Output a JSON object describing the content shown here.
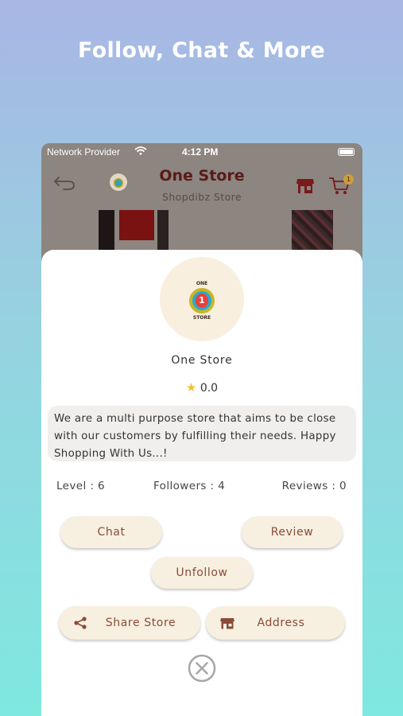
{
  "headline": "Follow, Chat & More",
  "status_bar": {
    "carrier": "Network Provider",
    "time": "4:12 PM"
  },
  "app_bar": {
    "title": "One Store",
    "subtitle": "Shopdibz Store",
    "cart_count": "1",
    "icons": [
      "back-arrow-icon",
      "store-logo-icon",
      "shop-icon",
      "cart-icon"
    ]
  },
  "store_card": {
    "name": "One Store",
    "rating": "0.0",
    "description": "We are a multi purpose store that aims to be close with our customers by fulfilling their needs. Happy Shopping With Us...!",
    "stats": {
      "level": "Level : 6",
      "followers": "Followers : 4",
      "reviews": "Reviews : 0"
    },
    "logo": {
      "top_text": "ONE",
      "number": "1",
      "bottom_text": "STORE"
    }
  },
  "actions": {
    "chat": "Chat",
    "review": "Review",
    "unfollow": "Unfollow",
    "share_store": "Share Store",
    "address": "Address"
  },
  "colors": {
    "accent_text": "#8a4b3a",
    "pill_bg": "#f7efdf",
    "title": "#5a1a1a"
  }
}
